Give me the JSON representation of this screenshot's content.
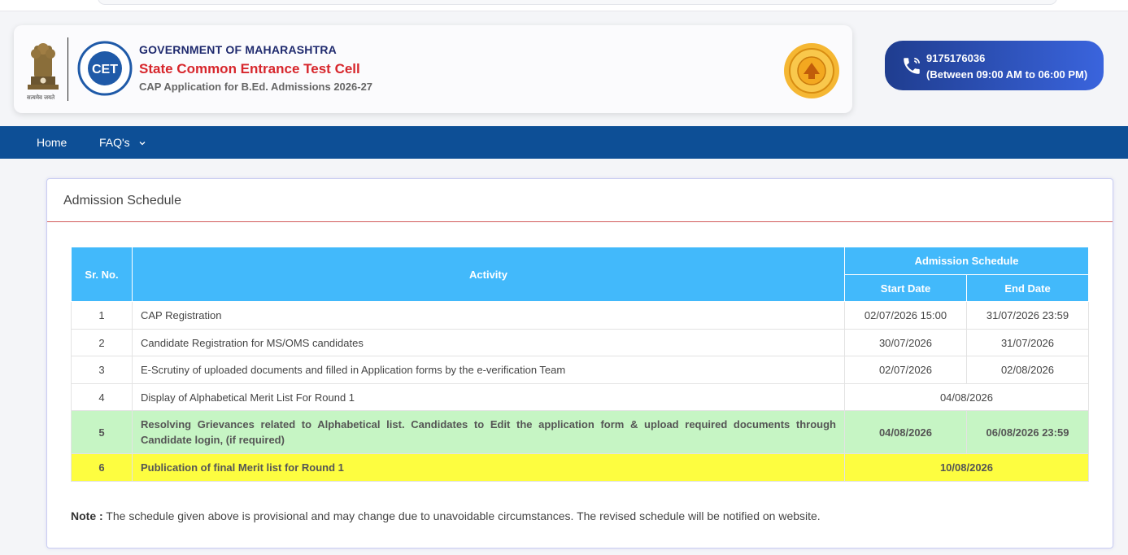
{
  "header": {
    "gov_title": "GOVERNMENT OF MAHARASHTRA",
    "cell_title": "State Common Entrance Test Cell",
    "cap_title": "CAP Application for B.Ed. Admissions 2026-27",
    "emblem_motto": "सत्यमेव जयते",
    "cet_logo_text": "CET"
  },
  "helpline": {
    "number": "9175176036",
    "hours": "(Between 09:00 AM to 06:00 PM)"
  },
  "nav": {
    "home": "Home",
    "faqs": "FAQ's"
  },
  "panel": {
    "title": "Admission Schedule"
  },
  "table": {
    "headers": {
      "sr": "Sr. No.",
      "activity": "Activity",
      "schedule": "Admission Schedule",
      "start": "Start Date",
      "end": "End Date"
    },
    "rows": [
      {
        "sr": "1",
        "activity": "CAP Registration",
        "start": "02/07/2026 15:00",
        "end": "31/07/2026 23:59"
      },
      {
        "sr": "2",
        "activity": "Candidate Registration for MS/OMS candidates",
        "start": "30/07/2026",
        "end": "31/07/2026"
      },
      {
        "sr": "3",
        "activity": "E-Scrutiny of uploaded documents and filled in Application forms by the e-verification Team",
        "start": "02/07/2026",
        "end": "02/08/2026"
      },
      {
        "sr": "4",
        "activity": "Display of Alphabetical Merit List For Round 1",
        "date": "04/08/2026"
      },
      {
        "sr": "5",
        "activity": "Resolving Grievances related to Alphabetical list. Candidates to Edit the application form & upload required documents through Candidate login, (if required)",
        "start": "04/08/2026",
        "end": "06/08/2026 23:59"
      },
      {
        "sr": "6",
        "activity": "Publication of final Merit list for Round 1",
        "date": "10/08/2026"
      }
    ]
  },
  "note": {
    "label": "Note :",
    "text": " The schedule given above is provisional and may change due to unavoidable circumstances. The revised schedule will be notified on website."
  },
  "colors": {
    "nav_bg": "#0d4f96",
    "table_header": "#42b9fb",
    "row_green": "#c6f5c4",
    "row_yellow": "#fdfd40",
    "title_red": "#d7262c"
  }
}
